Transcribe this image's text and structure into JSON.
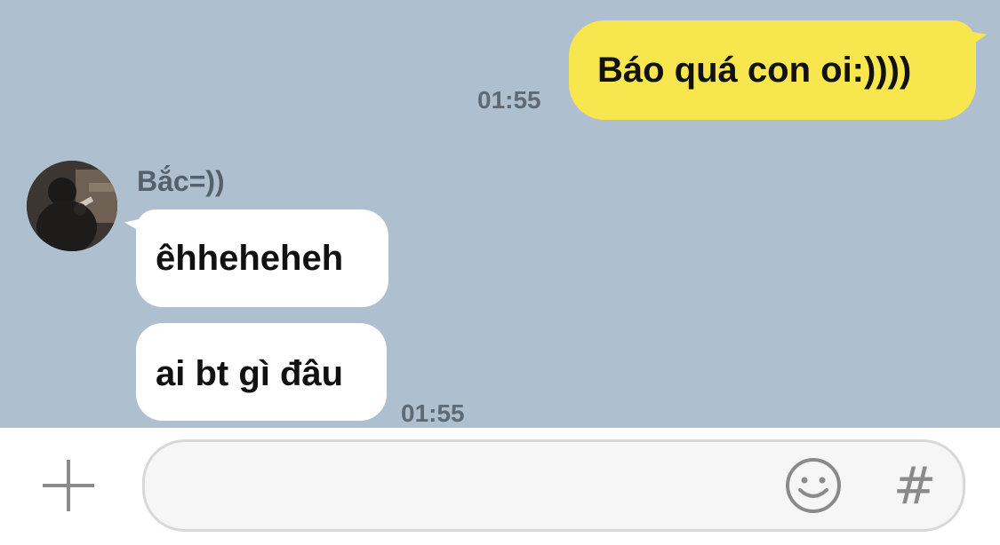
{
  "chat": {
    "outgoing": {
      "text": "Báo quá con oi:))))",
      "time": "01:55"
    },
    "incoming": {
      "sender": "Bắc=))",
      "messages": [
        "êhheheheh",
        "ai bt gì đâu"
      ],
      "time": "01:55"
    }
  },
  "input_bar": {
    "placeholder": "",
    "hash_label": "#"
  },
  "colors": {
    "chat_background": "#aebfcf",
    "outgoing_bubble": "#f8e64f",
    "incoming_bubble": "#ffffff"
  },
  "icons": [
    "user-avatar",
    "plus-icon",
    "emoji-icon",
    "hashtag-icon"
  ]
}
